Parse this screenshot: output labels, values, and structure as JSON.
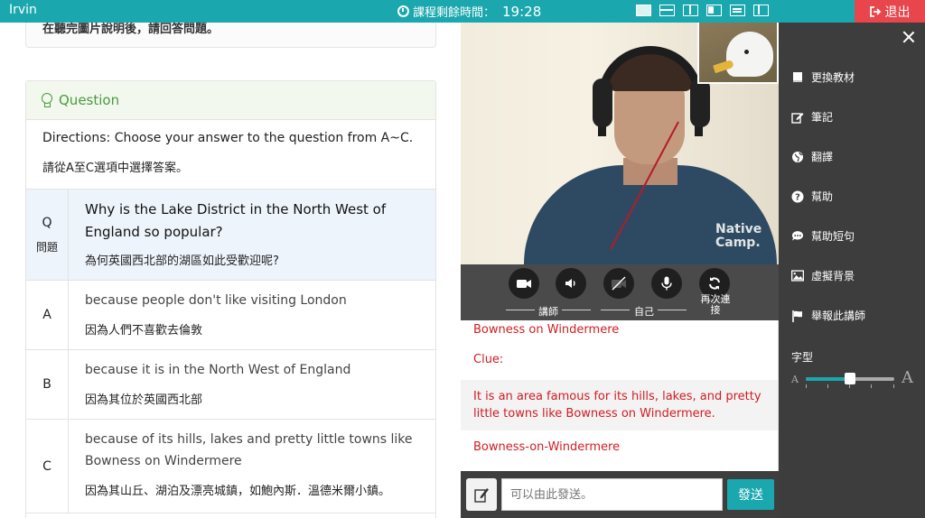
{
  "topbar": {
    "user": "Irvin",
    "timer_label": "課程剩餘時間：",
    "timer_value": "19:28",
    "layouts": [
      "layout-1",
      "layout-2",
      "layout-3",
      "layout-4",
      "layout-5",
      "layout-6"
    ],
    "exit_label": "退出"
  },
  "previous_prompt": "在聽完圖片說明後，請回答問題。",
  "question": {
    "header": "Question",
    "directions_en": "Directions: Choose your answer to the question from A~C.",
    "directions_zh": "請從A至C選項中選擇答案。",
    "q_label": "Q",
    "q_sub": "問題",
    "q_en": "Why is the Lake District in the North West of England so popular?",
    "q_zh": "為何英國西北部的湖區如此受歡迎呢?",
    "options": [
      {
        "label": "A",
        "en": "because people don't like visiting London",
        "zh": "因為人們不喜歡去倫敦"
      },
      {
        "label": "B",
        "en": "because it is in the North West of England",
        "zh": "因為其位於英國西北部"
      },
      {
        "label": "C",
        "en": "because of its hills, lakes and pretty little towns like Bowness on Windermere",
        "zh": "因為其山丘、湖泊及漂亮城鎮，如鮑內斯．溫德米爾小鎮。"
      }
    ]
  },
  "video": {
    "watermark_line1": "Native",
    "watermark_line2": "Camp."
  },
  "controls": {
    "tutor_label": "講師",
    "self_label": "自己",
    "reconnect_label": "再次連接"
  },
  "chat": {
    "messages": [
      "Bowness on Windermere",
      "Clue:",
      "It is an area famous for its hills, lakes, and pretty little towns like Bowness on Windermere.",
      "Bowness-on-Windermere"
    ],
    "input_placeholder": "可以由此發送。",
    "send_label": "發送"
  },
  "sidebar": {
    "items": [
      "更換教材",
      "筆記",
      "翻譯",
      "幫助",
      "幫助短句",
      "虛擬背景",
      "舉報此講師"
    ],
    "font_label": "字型",
    "font_small": "A",
    "font_large": "A",
    "font_size_level": 0.5
  },
  "colors": {
    "brand": "#1aa7ae",
    "exit": "#e9454c",
    "chat_text": "#d11d22",
    "question_green": "#4a9a3c"
  }
}
